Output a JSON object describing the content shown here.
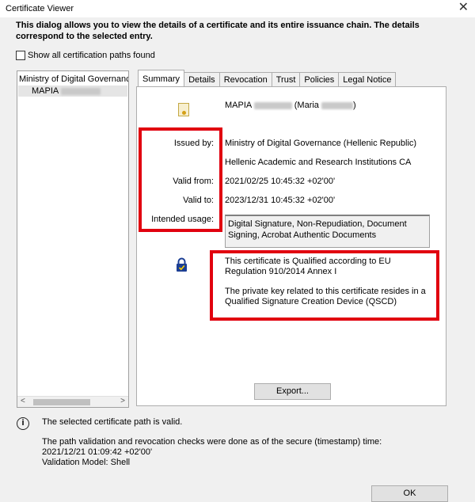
{
  "window": {
    "title": "Certificate Viewer",
    "close_glyph": "✕"
  },
  "intro_text": "This dialog allows you to view the details of a certificate and its entire issuance chain. The details correspond to the selected entry.",
  "show_all_paths_label": "Show all certification paths found",
  "tree": {
    "root": "Ministry of Digital Governance",
    "child_prefix": "MAPIA",
    "scroll_left": "<",
    "scroll_right": ">"
  },
  "tabs": [
    {
      "label": "Summary",
      "active": true
    },
    {
      "label": "Details"
    },
    {
      "label": "Revocation"
    },
    {
      "label": "Trust"
    },
    {
      "label": "Policies"
    },
    {
      "label": "Legal Notice"
    }
  ],
  "summary": {
    "subject_prefix": "MAPIA",
    "subject_mid": "(Maria",
    "subject_suffix": ")",
    "issued_by_label": "Issued by:",
    "issued_by_1": "Ministry of Digital Governance (Hellenic Republic)",
    "issued_by_2": "Hellenic Academic and Research Institutions CA",
    "valid_from_label": "Valid from:",
    "valid_from": "2021/02/25 10:45:32 +02'00'",
    "valid_to_label": "Valid to:",
    "valid_to": "2023/12/31 10:45:32 +02'00'",
    "intended_usage_label": "Intended usage:",
    "intended_usage": "Digital Signature, Non-Repudiation, Document Signing, Acrobat Authentic Documents",
    "qualified_1": "This certificate is Qualified according to EU Regulation 910/2014 Annex I",
    "qualified_2": "The private key related to this certificate resides in a Qualified Signature Creation Device (QSCD)",
    "export_label": "Export..."
  },
  "status": {
    "valid_msg": "The selected certificate path is valid.",
    "check_line1": "The path validation and revocation checks were done as of the secure (timestamp) time:",
    "check_line2": "2021/12/21 01:09:42 +02'00'",
    "check_line3": "Validation Model: Shell"
  },
  "ok_label": "OK",
  "colors": {
    "highlight_red": "#e1000f",
    "background": "#f0f0f0"
  },
  "icons": [
    "close-icon",
    "certificate-icon",
    "qualified-lock-icon",
    "info-icon"
  ]
}
